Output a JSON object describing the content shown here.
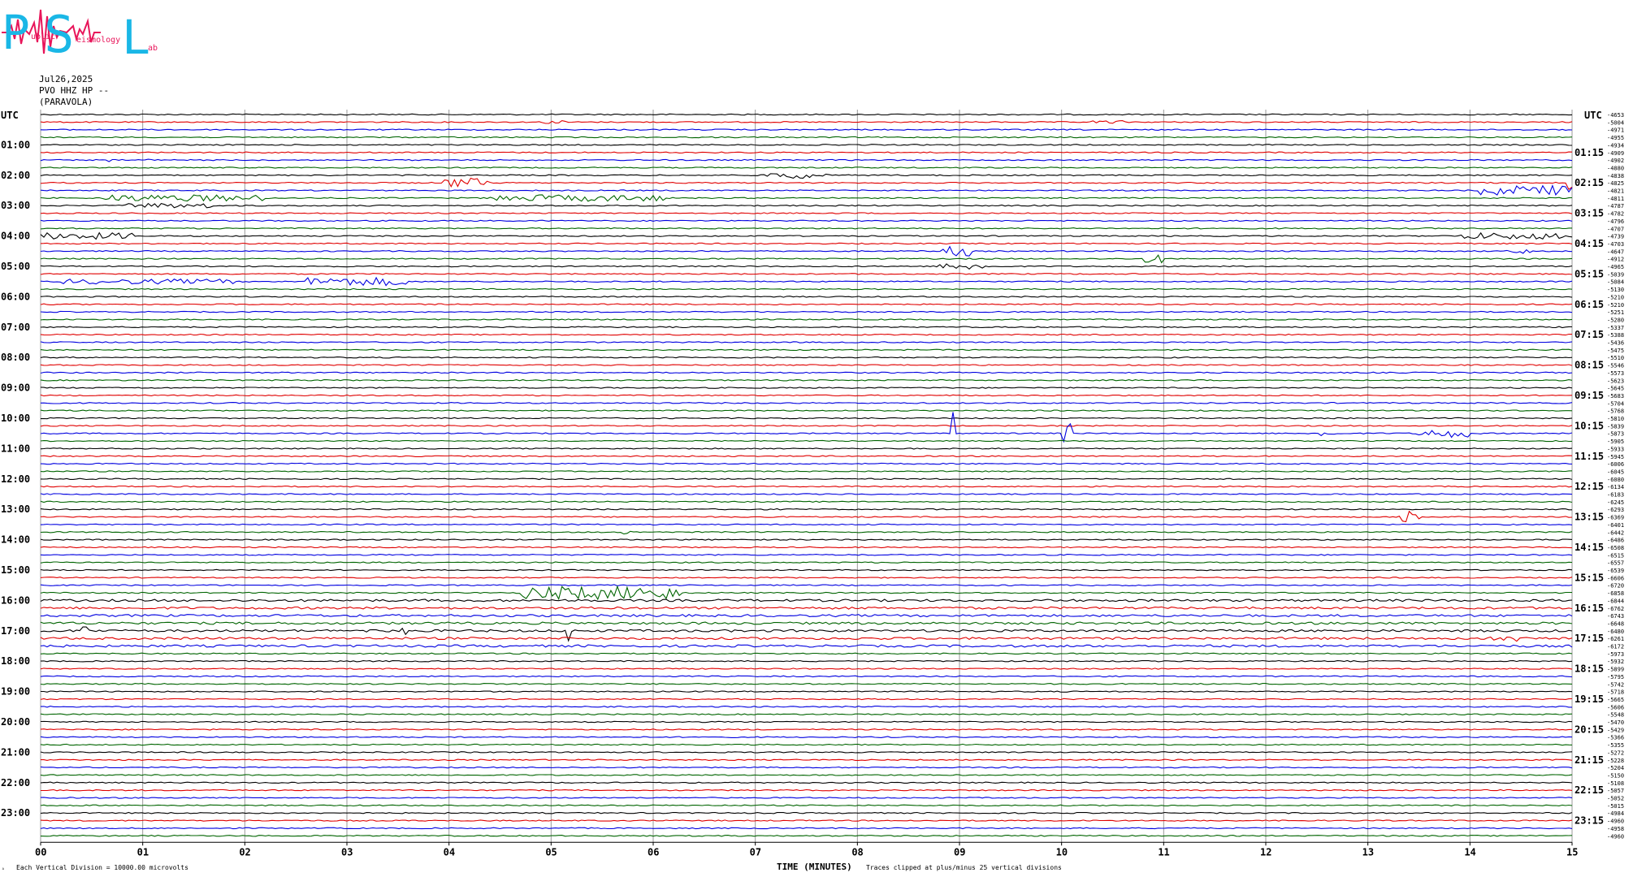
{
  "logo": {
    "letters": [
      "P",
      "S",
      "L"
    ],
    "small_words": [
      "ublic",
      "eismology",
      "ab"
    ],
    "colors": {
      "big": "#1ab7e6",
      "small": "#e8155a",
      "wave": "#e8155a"
    }
  },
  "header": {
    "date": "Jul26,2025",
    "station": "PVO HHZ HP --",
    "location": "(PARAVOLA)"
  },
  "footer": {
    "division": "Each Vertical Division = 10000.00 microvolts",
    "xlabel": "TIME (MINUTES)",
    "clip_note": "Traces clipped at plus/minus 25 vertical divisions"
  },
  "chart_data": {
    "type": "line",
    "xlabel": "TIME (MINUTES)",
    "xlim": [
      0,
      15
    ],
    "x_ticks": [
      "00",
      "01",
      "02",
      "03",
      "04",
      "05",
      "06",
      "07",
      "08",
      "09",
      "10",
      "11",
      "12",
      "13",
      "14",
      "15"
    ],
    "left_axis_title": "UTC",
    "right_axis_title": "UTC",
    "left_labels": [
      "01:00",
      "02:00",
      "03:00",
      "04:00",
      "05:00",
      "06:00",
      "07:00",
      "08:00",
      "09:00",
      "10:00",
      "11:00",
      "12:00",
      "13:00",
      "14:00",
      "15:00",
      "16:00",
      "17:00",
      "18:00",
      "19:00",
      "20:00",
      "21:00",
      "22:00",
      "23:00"
    ],
    "right_labels": [
      "01:15",
      "02:15",
      "03:15",
      "04:15",
      "05:15",
      "06:15",
      "07:15",
      "08:15",
      "09:15",
      "10:15",
      "11:15",
      "12:15",
      "13:15",
      "14:15",
      "15:15",
      "16:15",
      "17:15",
      "18:15",
      "19:15",
      "20:15",
      "21:15",
      "22:15",
      "23:15"
    ],
    "trace_offsets": [
      "-4653",
      "-5004",
      "-4971",
      "-4955",
      "-4934",
      "-4909",
      "-4902",
      "-4880",
      "-4838",
      "-4825",
      "-4821",
      "-4811",
      "-4787",
      "-4782",
      "-4796",
      "-4707",
      "-4739",
      "-4703",
      "-4647",
      "-4912",
      "-4965",
      "-5039",
      "-5084",
      "-5130",
      "-5210",
      "-5210",
      "-5251",
      "-5280",
      "-5337",
      "-5388",
      "-5436",
      "-5475",
      "-5510",
      "-5546",
      "-5573",
      "-5623",
      "-5645",
      "-5683",
      "-5704",
      "-5768",
      "-5810",
      "-5839",
      "-5873",
      "-5905",
      "-5933",
      "-5945",
      "-6006",
      "-6045",
      "-6080",
      "-6134",
      "-6183",
      "-6245",
      "-6293",
      "-6369",
      "-6401",
      "-6442",
      "-6486",
      "-6508",
      "-6515",
      "-6557",
      "-6539",
      "-6606",
      "-6720",
      "-6858",
      "-6844",
      "-6762",
      "-6743",
      "-6648",
      "-6480",
      "-6261",
      "-6172",
      "-5973",
      "-5932",
      "-5899",
      "-5795",
      "-5742",
      "-5718",
      "-5665",
      "-5606",
      "-5548",
      "-5470",
      "-5429",
      "-5366",
      "-5355",
      "-5272",
      "-5228",
      "-5204",
      "-5150",
      "-5108",
      "-5057",
      "-5052",
      "-5015",
      "-4984",
      "-4960",
      "-4958",
      "-4960"
    ],
    "trace_color_cycle": [
      "#000000",
      "#e00000",
      "#0000e0",
      "#006400"
    ],
    "series_count": 96,
    "minutes_per_line": 15,
    "grid": true
  }
}
